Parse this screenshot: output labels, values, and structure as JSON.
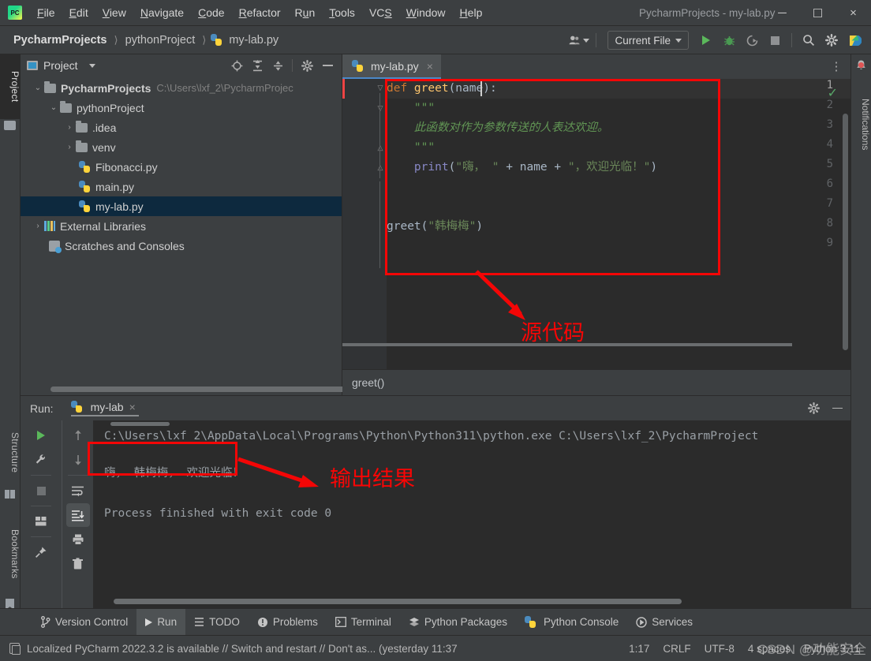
{
  "window": {
    "title": "PycharmProjects - my-lab.py",
    "logo": "pycharm-logo",
    "minimize": "─",
    "maximize": "☐",
    "close": "×"
  },
  "menu": [
    {
      "label": "File",
      "mnemonic": "F"
    },
    {
      "label": "Edit",
      "mnemonic": "E"
    },
    {
      "label": "View",
      "mnemonic": "V"
    },
    {
      "label": "Navigate",
      "mnemonic": "N"
    },
    {
      "label": "Code",
      "mnemonic": "C"
    },
    {
      "label": "Refactor",
      "mnemonic": "R"
    },
    {
      "label": "Run",
      "mnemonic": "u"
    },
    {
      "label": "Tools",
      "mnemonic": "T"
    },
    {
      "label": "VCS",
      "mnemonic": "S"
    },
    {
      "label": "Window",
      "mnemonic": "W"
    },
    {
      "label": "Help",
      "mnemonic": "H"
    }
  ],
  "navbar": {
    "breadcrumbs": [
      "PycharmProjects",
      "pythonProject",
      "my-lab.py"
    ],
    "separator": "〉",
    "run_config": "Current File",
    "icons": [
      "user-avatar-icon",
      "run-icon",
      "debug-icon",
      "run-coverage-icon",
      "stop-icon",
      "search-everywhere-icon",
      "settings-icon",
      "ai-assistant-icon"
    ]
  },
  "left_stripe": {
    "project_tab": "Project",
    "structure_tab": "Structure",
    "bookmarks_tab": "Bookmarks"
  },
  "right_stripe": {
    "notifications_tab": "Notifications"
  },
  "project_panel": {
    "title": "Project",
    "header_icons": [
      "select-opened-file-icon",
      "expand-all-icon",
      "collapse-all-icon",
      "settings-icon",
      "hide-icon"
    ],
    "tree": [
      {
        "label": "PycharmProjects",
        "path": "C:\\Users\\lxf_2\\PycharmProjec",
        "indent": 0,
        "arrow": "⌄",
        "icon": "folder-icon",
        "bold": true,
        "selected": false
      },
      {
        "label": "pythonProject",
        "path": "",
        "indent": 1,
        "arrow": "⌄",
        "icon": "folder-icon",
        "bold": false,
        "selected": false
      },
      {
        "label": ".idea",
        "path": "",
        "indent": 2,
        "arrow": "›",
        "icon": "folder-icon",
        "bold": false,
        "selected": false
      },
      {
        "label": "venv",
        "path": "",
        "indent": 2,
        "arrow": "›",
        "icon": "folder-icon",
        "bold": false,
        "selected": false
      },
      {
        "label": "Fibonacci.py",
        "path": "",
        "indent": 3,
        "arrow": "",
        "icon": "python-file-icon",
        "bold": false,
        "selected": false
      },
      {
        "label": "main.py",
        "path": "",
        "indent": 3,
        "arrow": "",
        "icon": "python-file-icon",
        "bold": false,
        "selected": false
      },
      {
        "label": "my-lab.py",
        "path": "",
        "indent": 3,
        "arrow": "",
        "icon": "python-file-icon",
        "bold": false,
        "selected": true
      },
      {
        "label": "External Libraries",
        "path": "",
        "indent": 0,
        "arrow": "›",
        "icon": "library-icon",
        "bold": false,
        "selected": false
      },
      {
        "label": "Scratches and Consoles",
        "path": "",
        "indent": 1,
        "arrow": "",
        "icon": "scratches-icon",
        "bold": false,
        "selected": false
      }
    ]
  },
  "editor": {
    "tab": {
      "label": "my-lab.py",
      "icon": "python-file-icon",
      "close": "×"
    },
    "more_icon": "⋮",
    "inspection_status": "✓",
    "line_numbers": [
      "1",
      "2",
      "3",
      "4",
      "5",
      "6",
      "7",
      "8",
      "9"
    ],
    "code": [
      {
        "num": 1,
        "tokens": [
          {
            "t": "def ",
            "c": "k-def"
          },
          {
            "t": "greet",
            "c": "k-fn"
          },
          {
            "t": "(name):",
            "c": "k-pl"
          }
        ]
      },
      {
        "num": 2,
        "tokens": [
          {
            "t": "    \"\"\"",
            "c": "k-doc"
          }
        ]
      },
      {
        "num": 3,
        "tokens": [
          {
            "t": "    此函数对作为参数传送的人表达欢迎。",
            "c": "k-doc"
          }
        ]
      },
      {
        "num": 4,
        "tokens": [
          {
            "t": "    \"\"\"",
            "c": "k-doc"
          }
        ]
      },
      {
        "num": 5,
        "tokens": [
          {
            "t": "    ",
            "c": "k-pl"
          },
          {
            "t": "print",
            "c": "k-bi"
          },
          {
            "t": "(",
            "c": "k-pl"
          },
          {
            "t": "\"嗨， \"",
            "c": "k-str"
          },
          {
            "t": " + ",
            "c": "k-pl"
          },
          {
            "t": "name",
            "c": "k-pl"
          },
          {
            "t": " + ",
            "c": "k-pl"
          },
          {
            "t": "\"， 欢迎光临！\"",
            "c": "k-str"
          },
          {
            "t": ")",
            "c": "k-pl"
          }
        ]
      },
      {
        "num": 6,
        "tokens": []
      },
      {
        "num": 7,
        "tokens": []
      },
      {
        "num": 8,
        "tokens": [
          {
            "t": "greet",
            "c": "k-pl"
          },
          {
            "t": "(",
            "c": "k-pl"
          },
          {
            "t": "\"韩梅梅\"",
            "c": "k-str"
          },
          {
            "t": ")",
            "c": "k-pl"
          }
        ]
      },
      {
        "num": 9,
        "tokens": []
      }
    ],
    "breadcrumb": "greet()"
  },
  "run_panel": {
    "label": "Run:",
    "tab": {
      "label": "my-lab",
      "icon": "python-file-icon",
      "close": "×"
    },
    "header_icons": [
      "settings-icon",
      "hide-icon"
    ],
    "left_tool_icons": [
      "rerun-icon",
      "run-settings-icon",
      "stop-icon",
      "layout-icon",
      "pin-tab-icon"
    ],
    "right_tool_icons": [
      "prev-occurrence-icon",
      "next-occurrence-icon",
      "soft-wrap-icon",
      "scroll-to-end-icon",
      "print-icon",
      "clear-all-icon"
    ],
    "console": [
      "C:\\Users\\lxf_2\\AppData\\Local\\Programs\\Python\\Python311\\python.exe C:\\Users\\lxf_2\\PycharmProject",
      "嗨， 韩梅梅， 欢迎光临！",
      "",
      "Process finished with exit code 0"
    ]
  },
  "tool_window_bar": [
    {
      "label": "Version Control",
      "icon": "branch-icon",
      "active": false
    },
    {
      "label": "Run",
      "icon": "run-icon",
      "active": true
    },
    {
      "label": "TODO",
      "icon": "todo-icon",
      "active": false
    },
    {
      "label": "Problems",
      "icon": "problems-icon",
      "active": false
    },
    {
      "label": "Terminal",
      "icon": "terminal-icon",
      "active": false
    },
    {
      "label": "Python Packages",
      "icon": "packages-icon",
      "active": false
    },
    {
      "label": "Python Console",
      "icon": "python-console-icon",
      "active": false
    },
    {
      "label": "Services",
      "icon": "services-icon",
      "active": false
    }
  ],
  "status_bar": {
    "icon": "notification-icon",
    "message": "Localized PyCharm 2022.3.2 is available // Switch and restart // Don't as... (yesterday 11:37",
    "caret_position": "1:17",
    "line_separator": "CRLF",
    "encoding": "UTF-8",
    "indent": "4 spaces",
    "branch": "Python 3.11"
  },
  "annotations": {
    "source_code_label": "源代码",
    "output_label": "输出结果",
    "accent_red": "#f40606"
  },
  "watermark": "CSDN @功能安全"
}
